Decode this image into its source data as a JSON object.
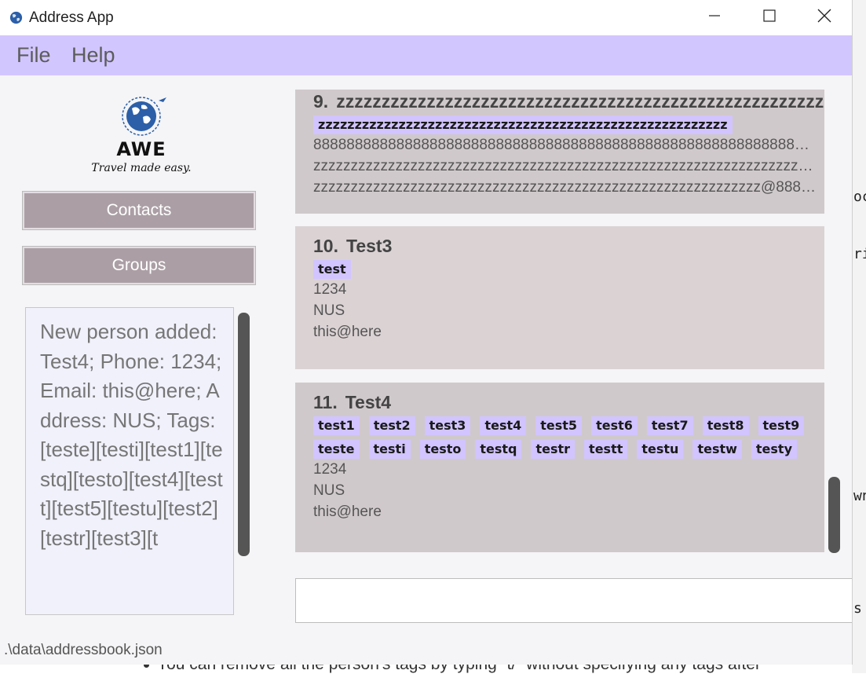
{
  "window": {
    "title": "Address App",
    "controls": {
      "minimize": "minimize-icon",
      "maximize": "maximize-icon",
      "close": "close-icon"
    }
  },
  "menu": {
    "file": "File",
    "help": "Help"
  },
  "logo": {
    "name": "AWE",
    "tagline": "Travel made easy."
  },
  "nav": {
    "contacts": "Contacts",
    "groups": "Groups"
  },
  "result": {
    "text": "New person added: Test4; Phone: 1234; Email: this@here; Address: NUS; Tags: [teste][testi][test1][testq][testo][test4][testt][test5][testu][test2][testr][test3][t"
  },
  "persons": [
    {
      "index": "9.",
      "name": "zzzzzzzzzzzzzzzzzzzzzzzzzzzzzzzzzzzzzzzzzzzzzzzzzzzzzzzzzzzzzzzz...",
      "tags": [
        "zzzzzzzzzzzzzzzzzzzzzzzzzzzzzzzzzzzzzzzzzzzzzzzzzzzzzzzz"
      ],
      "phone": "88888888888888888888888888888888888888888888888888888888888888888...",
      "address": "zzzzzzzzzzzzzzzzzzzzzzzzzzzzzzzzzzzzzzzzzzzzzzzzzzzzzzzzzzzzzzzzzzzzz...",
      "email": "zzzzzzzzzzzzzzzzzzzzzzzzzzzzzzzzzzzzzzzzzzzzzzzzzzzzzzzzzzzz@88888888..."
    },
    {
      "index": "10.",
      "name": "Test3",
      "tags": [
        "test"
      ],
      "phone": "1234",
      "address": "NUS",
      "email": "this@here"
    },
    {
      "index": "11.",
      "name": "Test4",
      "tags": [
        "test1",
        "test2",
        "test3",
        "test4",
        "test5",
        "test6",
        "test7",
        "test8",
        "test9",
        "teste",
        "testi",
        "testo",
        "testq",
        "testr",
        "testt",
        "testu",
        "testw",
        "testy"
      ],
      "phone": "1234",
      "address": "NUS",
      "email": "this@here"
    }
  ],
  "command": {
    "value": ""
  },
  "status": {
    "path": ".\\data\\addressbook.json"
  },
  "background": {
    "fragment_1": "oc",
    "fragment_2": "ri",
    "fragment_3": "wn",
    "fragment_4": "s",
    "line": "You can remove all the person's tags by typing `t/` without specifying any tags after"
  },
  "colors": {
    "menubar": "#d2c6ff",
    "tag": "#d1c4ff",
    "card": "#d0c9cb",
    "nav_button": "#ab9fa5"
  }
}
